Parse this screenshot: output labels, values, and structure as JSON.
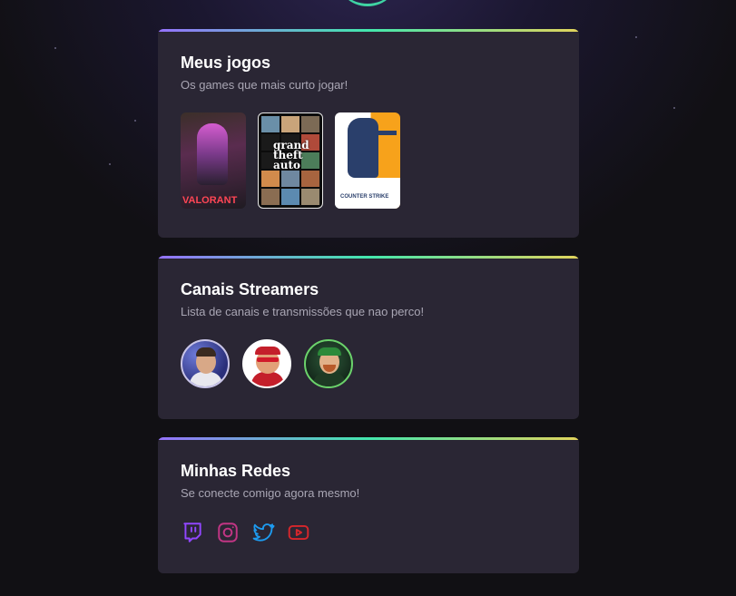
{
  "cards": {
    "games": {
      "title": "Meus jogos",
      "subtitle": "Os games que mais curto jogar!",
      "items": [
        {
          "name": "Valorant",
          "label": "VALORANT"
        },
        {
          "name": "Grand Theft Auto V",
          "label": "grand theft auto"
        },
        {
          "name": "Counter-Strike",
          "label": "COUNTER STRIKE"
        }
      ]
    },
    "streamers": {
      "title": "Canais Streamers",
      "subtitle": "Lista de canais e transmissões que nao perco!"
    },
    "social": {
      "title": "Minhas Redes",
      "subtitle": "Se conecte comigo agora mesmo!",
      "links": [
        {
          "icon": "twitch-icon",
          "color": "#9146ff"
        },
        {
          "icon": "instagram-icon",
          "color": "#c13584"
        },
        {
          "icon": "twitter-icon",
          "color": "#1d9bf0"
        },
        {
          "icon": "youtube-icon",
          "color": "#d7262b"
        }
      ]
    }
  },
  "colors": {
    "accent_gradient": [
      "#9572fc",
      "#43e7ad",
      "#e2d45c"
    ],
    "card_background": "#2a2634",
    "page_background": "#111014"
  }
}
